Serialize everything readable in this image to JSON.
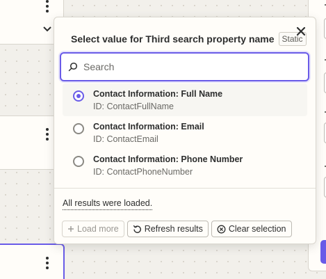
{
  "popover": {
    "title": "Select value for Third search property name",
    "badge": "Static",
    "search": {
      "placeholder": "Search",
      "value": ""
    },
    "options": [
      {
        "label": "Contact Information: Full Name",
        "id_text": "ID: ContactFullName",
        "selected": true
      },
      {
        "label": "Contact Information: Email",
        "id_text": "ID: ContactEmail",
        "selected": false
      },
      {
        "label": "Contact Information: Phone Number",
        "id_text": "ID: ContactPhoneNumber",
        "selected": false
      }
    ],
    "status_text": "All results were loaded.",
    "buttons": {
      "load_more": "Load more",
      "refresh": "Refresh results",
      "clear": "Clear selection"
    }
  },
  "icons": {
    "close": "close-icon",
    "search": "search-icon",
    "plus": "plus-icon",
    "refresh": "refresh-icon",
    "clear": "clear-circle-icon",
    "kebab": "kebab-menu-icon",
    "chevron": "chevron-down-icon"
  },
  "colors": {
    "accent": "#695be8",
    "canvas": "#f2f0eb",
    "surface": "#fffdf9",
    "text": "#2d2e2e",
    "muted": "#6a6965"
  }
}
